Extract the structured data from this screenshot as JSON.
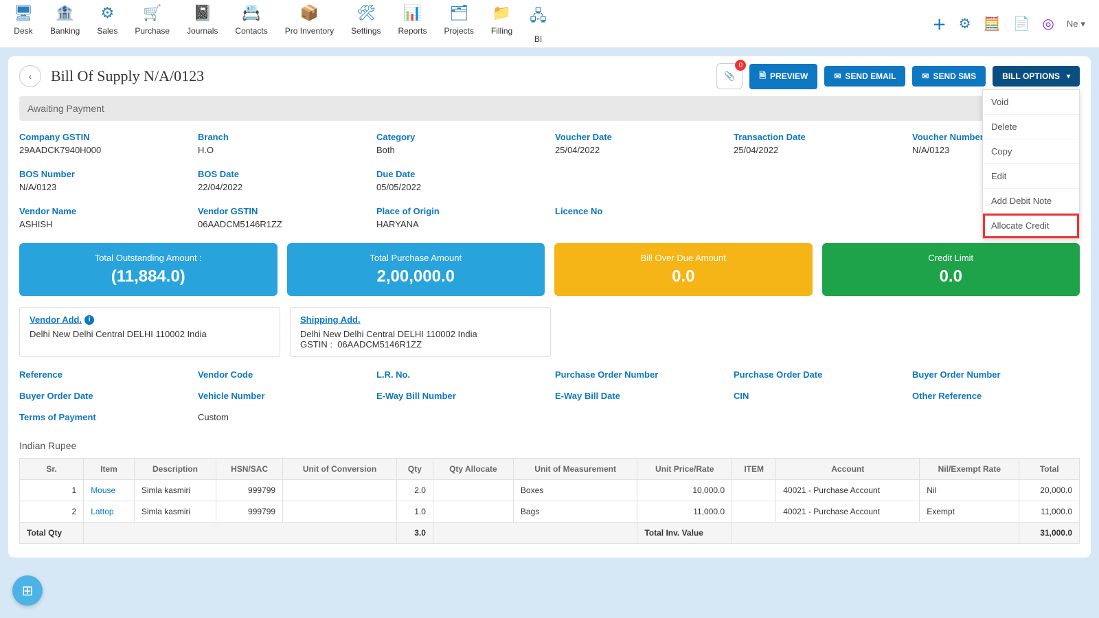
{
  "nav": {
    "items": [
      {
        "label": "Desk",
        "glyph": "🖥"
      },
      {
        "label": "Banking",
        "glyph": "🏦"
      },
      {
        "label": "Sales",
        "glyph": "⚙"
      },
      {
        "label": "Purchase",
        "glyph": "🛒"
      },
      {
        "label": "Journals",
        "glyph": "📓"
      },
      {
        "label": "Contacts",
        "glyph": "📇"
      },
      {
        "label": "Pro Inventory",
        "glyph": "📦"
      },
      {
        "label": "Settings",
        "glyph": "🛠"
      },
      {
        "label": "Reports",
        "glyph": "📊"
      },
      {
        "label": "Projects",
        "glyph": "🗂"
      },
      {
        "label": "Filling",
        "glyph": "📁"
      },
      {
        "label": "BI",
        "glyph": "🖧"
      }
    ]
  },
  "user_short": "Ne",
  "page_title": "Bill Of Supply N/A/0123",
  "status": "Awaiting Payment",
  "badge_count": "0",
  "buttons": {
    "preview": "PREVIEW",
    "send_email": "SEND EMAIL",
    "send_sms": "SEND SMS",
    "bill_options": "BILL OPTIONS"
  },
  "bill_options_menu": [
    "Void",
    "Delete",
    "Copy",
    "Edit",
    "Add Debit Note",
    "Allocate Credit"
  ],
  "bill_options_highlight_index": 5,
  "info": {
    "company_gstin": {
      "label": "Company GSTIN",
      "value": "29AADCK7940H000"
    },
    "branch": {
      "label": "Branch",
      "value": "H.O"
    },
    "category": {
      "label": "Category",
      "value": "Both"
    },
    "voucher_date": {
      "label": "Voucher Date",
      "value": "25/04/2022"
    },
    "transaction_date": {
      "label": "Transaction Date",
      "value": "25/04/2022"
    },
    "voucher_number": {
      "label": "Voucher Number",
      "value": "N/A/0123"
    },
    "bos_number": {
      "label": "BOS Number",
      "value": "N/A/0123"
    },
    "bos_date": {
      "label": "BOS Date",
      "value": "22/04/2022"
    },
    "due_date": {
      "label": "Due Date",
      "value": "05/05/2022"
    },
    "vendor_name": {
      "label": "Vendor Name",
      "value": "ASHISH"
    },
    "vendor_gstin": {
      "label": "Vendor GSTIN",
      "value": "06AADCM5146R1ZZ"
    },
    "place_of_origin": {
      "label": "Place of Origin",
      "value": "HARYANA"
    },
    "licence_no": {
      "label": "Licence No",
      "value": ""
    }
  },
  "summary": {
    "outstanding": {
      "label": "Total Outstanding Amount :",
      "value": "(11,884.0)"
    },
    "purchase": {
      "label": "Total Purchase Amount",
      "value": "2,00,000.0"
    },
    "overdue": {
      "label": "Bill Over Due Amount",
      "value": "0.0"
    },
    "credit": {
      "label": "Credit Limit",
      "value": "0.0"
    }
  },
  "addresses": {
    "vendor": {
      "title": "Vendor Add.",
      "line1": "Delhi New Delhi Central DELHI 110002 India"
    },
    "shipping": {
      "title": "Shipping Add.",
      "line1": "Delhi New Delhi Central DELHI 110002 India",
      "gstin_label": "GSTIN :",
      "gstin": "06AADCM5146R1ZZ"
    }
  },
  "refs": {
    "r1": [
      "Reference",
      "Vendor Code",
      "L.R. No.",
      "Purchase Order Number",
      "Purchase Order Date",
      "Buyer Order Number"
    ],
    "r2": [
      "Buyer Order Date",
      "Vehicle Number",
      "E-Way Bill Number",
      "E-Way Bill Date",
      "CIN",
      "Other Reference"
    ],
    "r3": [
      "Terms of Payment",
      "Custom"
    ]
  },
  "currency": "Indian Rupee",
  "table": {
    "headers": [
      "Sr.",
      "Item",
      "Description",
      "HSN/SAC",
      "Unit of Conversion",
      "Qty",
      "Qty Allocate",
      "Unit of Measurement",
      "Unit Price/Rate",
      "ITEM",
      "Account",
      "Nil/Exempt Rate",
      "Total"
    ],
    "rows": [
      {
        "sr": "1",
        "item": "Mouse",
        "desc": "Simla kasmiri",
        "hsn": "999799",
        "uoc": "",
        "qty": "2.0",
        "alloc": "",
        "uom": "Boxes",
        "rate": "10,000.0",
        "itemcol": "",
        "account": "40021 - Purchase Account",
        "nil": "Nil",
        "total": "20,000.0"
      },
      {
        "sr": "2",
        "item": "Lattop",
        "desc": "Simla kasmiri",
        "hsn": "999799",
        "uoc": "",
        "qty": "1.0",
        "alloc": "",
        "uom": "Bags",
        "rate": "11,000.0",
        "itemcol": "",
        "account": "40021 - Purchase Account",
        "nil": "Exempt",
        "total": "11,000.0"
      }
    ],
    "footer": {
      "total_qty_label": "Total Qty",
      "total_qty": "3.0",
      "inv_label": "Total Inv. Value",
      "inv_total": "31,000.0"
    }
  }
}
